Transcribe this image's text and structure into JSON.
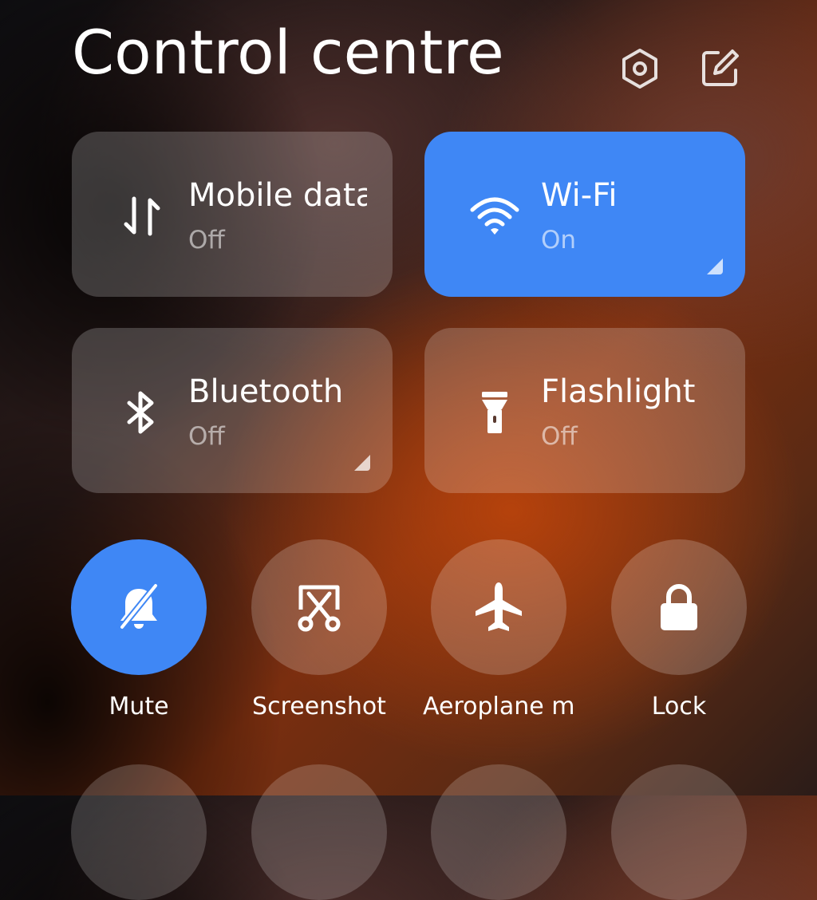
{
  "header": {
    "title": "Control centre",
    "settings_icon": "settings-hexagon-icon",
    "edit_icon": "edit-icon"
  },
  "tiles": [
    {
      "name": "Mobile data",
      "state": "Off",
      "icon": "mobile-data-icon",
      "active": false
    },
    {
      "name": "Wi-Fi",
      "state": "On",
      "icon": "wifi-icon",
      "active": true
    },
    {
      "name": "Bluetooth",
      "state": "Off",
      "icon": "bluetooth-icon",
      "active": false
    },
    {
      "name": "Flashlight",
      "state": "Off",
      "icon": "flashlight-icon",
      "active": false
    }
  ],
  "toggles": [
    {
      "label": "Mute",
      "icon": "bell-off-icon",
      "active": true
    },
    {
      "label": "Screenshot",
      "icon": "scissors-icon",
      "active": false
    },
    {
      "label": "Aeroplane m",
      "icon": "airplane-icon",
      "active": false
    },
    {
      "label": "Lock",
      "icon": "lock-icon",
      "active": false
    }
  ],
  "colors": {
    "accent": "#3f87f5",
    "tile_inactive": "rgba(255,255,255,0.20)",
    "text": "#ffffff"
  }
}
